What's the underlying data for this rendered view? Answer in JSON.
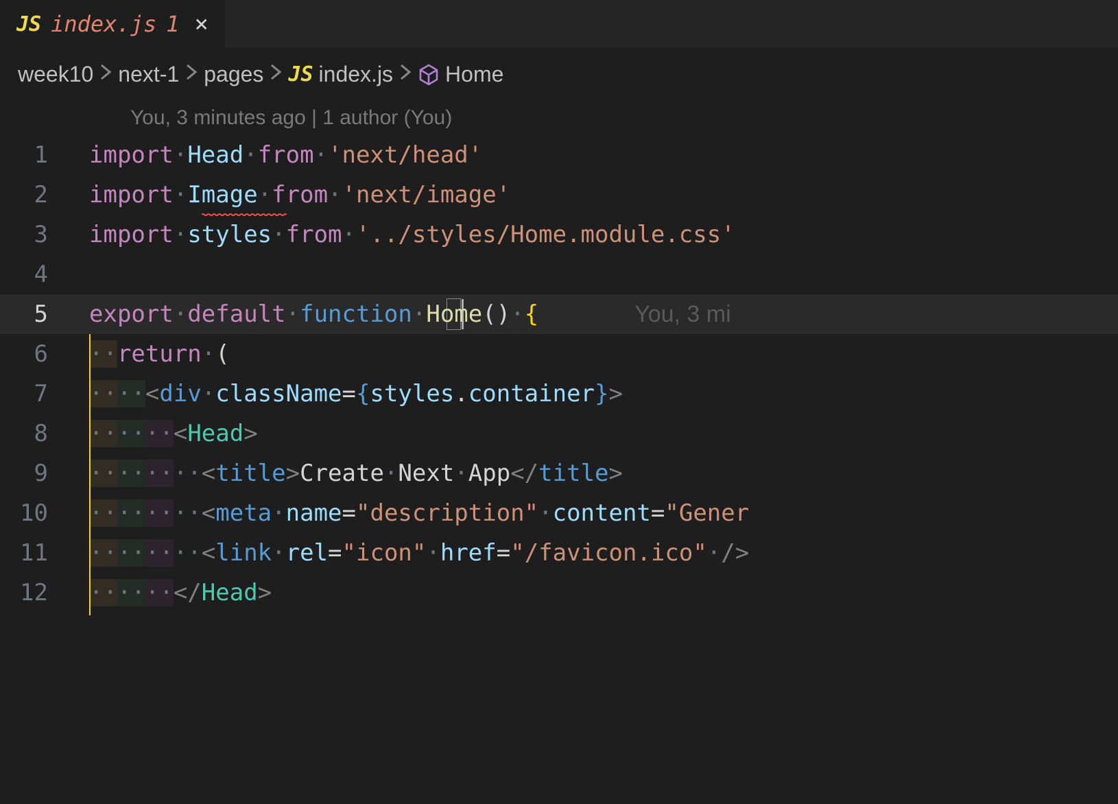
{
  "tab": {
    "icon_label": "JS",
    "filename": "index.js",
    "badge": "1"
  },
  "breadcrumb": {
    "items": [
      "week10",
      "next-1",
      "pages"
    ],
    "file_icon": "JS",
    "filename": "index.js",
    "symbol": "Home"
  },
  "codelens": "You, 3 minutes ago | 1 author (You)",
  "blame_inline": "You, 3 mi",
  "lines": {
    "1": {
      "num": "1",
      "tokens": [
        {
          "t": "import",
          "c": "tok-keyword"
        },
        {
          "t": "·",
          "c": "tok-dot"
        },
        {
          "t": "Head",
          "c": "tok-variable"
        },
        {
          "t": "·",
          "c": "tok-dot"
        },
        {
          "t": "from",
          "c": "tok-keyword"
        },
        {
          "t": "·",
          "c": "tok-dot"
        },
        {
          "t": "'next/head'",
          "c": "tok-string"
        }
      ]
    },
    "2": {
      "num": "2",
      "tokens": [
        {
          "t": "import",
          "c": "tok-keyword"
        },
        {
          "t": "·",
          "c": "tok-dot"
        },
        {
          "t": "Image",
          "c": "tok-variable"
        },
        {
          "t": "·",
          "c": "tok-dot"
        },
        {
          "t": "from",
          "c": "tok-keyword"
        },
        {
          "t": "·",
          "c": "tok-dot"
        },
        {
          "t": "'next/image'",
          "c": "tok-string"
        }
      ]
    },
    "3": {
      "num": "3",
      "tokens": [
        {
          "t": "import",
          "c": "tok-keyword"
        },
        {
          "t": "·",
          "c": "tok-dot"
        },
        {
          "t": "styles",
          "c": "tok-variable"
        },
        {
          "t": "·",
          "c": "tok-dot"
        },
        {
          "t": "from",
          "c": "tok-keyword"
        },
        {
          "t": "·",
          "c": "tok-dot"
        },
        {
          "t": "'../styles/Home.module.css'",
          "c": "tok-string"
        }
      ]
    },
    "4": {
      "num": "4",
      "tokens": []
    },
    "5": {
      "num": "5",
      "tokens": [
        {
          "t": "export",
          "c": "tok-keyword"
        },
        {
          "t": "·",
          "c": "tok-dot"
        },
        {
          "t": "default",
          "c": "tok-keyword"
        },
        {
          "t": "·",
          "c": "tok-dot"
        },
        {
          "t": "function",
          "c": "tok-storage"
        },
        {
          "t": "·",
          "c": "tok-dot"
        },
        {
          "t": "Home",
          "c": "tok-function"
        },
        {
          "t": "()",
          "c": "tok-punct"
        },
        {
          "t": "·",
          "c": "tok-dot"
        },
        {
          "t": "{",
          "c": "tok-brace"
        }
      ]
    },
    "6": {
      "num": "6",
      "tokens": [
        {
          "t": "··",
          "c": "tok-dot"
        },
        {
          "t": "return",
          "c": "tok-keyword"
        },
        {
          "t": "·",
          "c": "tok-dot"
        },
        {
          "t": "(",
          "c": "tok-punct"
        }
      ]
    },
    "7": {
      "num": "7",
      "tokens": [
        {
          "t": "····",
          "c": "tok-dot"
        },
        {
          "t": "<",
          "c": "tok-bracket"
        },
        {
          "t": "div",
          "c": "tok-storage"
        },
        {
          "t": "·",
          "c": "tok-dot"
        },
        {
          "t": "className",
          "c": "tok-attr"
        },
        {
          "t": "=",
          "c": "tok-punct"
        },
        {
          "t": "{",
          "c": "tok-storage"
        },
        {
          "t": "styles",
          "c": "tok-variable"
        },
        {
          "t": ".",
          "c": "tok-punct"
        },
        {
          "t": "container",
          "c": "tok-prop"
        },
        {
          "t": "}",
          "c": "tok-storage"
        },
        {
          "t": ">",
          "c": "tok-bracket"
        }
      ]
    },
    "8": {
      "num": "8",
      "tokens": [
        {
          "t": "······",
          "c": "tok-dot"
        },
        {
          "t": "<",
          "c": "tok-bracket"
        },
        {
          "t": "Head",
          "c": "tok-tag"
        },
        {
          "t": ">",
          "c": "tok-bracket"
        }
      ]
    },
    "9": {
      "num": "9",
      "tokens": [
        {
          "t": "········",
          "c": "tok-dot"
        },
        {
          "t": "<",
          "c": "tok-bracket"
        },
        {
          "t": "title",
          "c": "tok-storage"
        },
        {
          "t": ">",
          "c": "tok-bracket"
        },
        {
          "t": "Create",
          "c": "tok-text"
        },
        {
          "t": "·",
          "c": "tok-dot"
        },
        {
          "t": "Next",
          "c": "tok-text"
        },
        {
          "t": "·",
          "c": "tok-dot"
        },
        {
          "t": "App",
          "c": "tok-text"
        },
        {
          "t": "</",
          "c": "tok-bracket"
        },
        {
          "t": "title",
          "c": "tok-storage"
        },
        {
          "t": ">",
          "c": "tok-bracket"
        }
      ]
    },
    "10": {
      "num": "10",
      "tokens": [
        {
          "t": "········",
          "c": "tok-dot"
        },
        {
          "t": "<",
          "c": "tok-bracket"
        },
        {
          "t": "meta",
          "c": "tok-storage"
        },
        {
          "t": "·",
          "c": "tok-dot"
        },
        {
          "t": "name",
          "c": "tok-attr"
        },
        {
          "t": "=",
          "c": "tok-punct"
        },
        {
          "t": "\"description\"",
          "c": "tok-string"
        },
        {
          "t": "·",
          "c": "tok-dot"
        },
        {
          "t": "content",
          "c": "tok-attr"
        },
        {
          "t": "=",
          "c": "tok-punct"
        },
        {
          "t": "\"Gener",
          "c": "tok-string"
        }
      ]
    },
    "11": {
      "num": "11",
      "tokens": [
        {
          "t": "········",
          "c": "tok-dot"
        },
        {
          "t": "<",
          "c": "tok-bracket"
        },
        {
          "t": "link",
          "c": "tok-storage"
        },
        {
          "t": "·",
          "c": "tok-dot"
        },
        {
          "t": "rel",
          "c": "tok-attr"
        },
        {
          "t": "=",
          "c": "tok-punct"
        },
        {
          "t": "\"icon\"",
          "c": "tok-string"
        },
        {
          "t": "·",
          "c": "tok-dot"
        },
        {
          "t": "href",
          "c": "tok-attr"
        },
        {
          "t": "=",
          "c": "tok-punct"
        },
        {
          "t": "\"/favicon.ico\"",
          "c": "tok-string"
        },
        {
          "t": "·",
          "c": "tok-dot"
        },
        {
          "t": "/>",
          "c": "tok-bracket"
        }
      ]
    },
    "12": {
      "num": "12",
      "tokens": [
        {
          "t": "······",
          "c": "tok-dot"
        },
        {
          "t": "</",
          "c": "tok-bracket"
        },
        {
          "t": "Head",
          "c": "tok-tag"
        },
        {
          "t": ">",
          "c": "tok-bracket"
        }
      ]
    }
  }
}
